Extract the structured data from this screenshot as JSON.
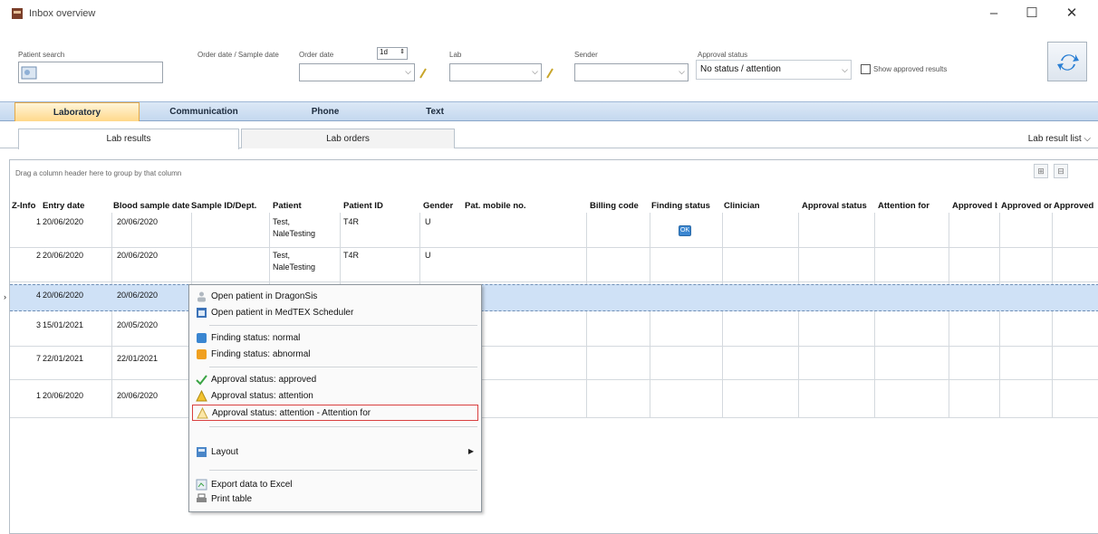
{
  "window": {
    "title": "Inbox overview",
    "minimize": "–",
    "maximize": "☐",
    "close": "✕"
  },
  "filters": {
    "patient_search_label": "Patient search",
    "order_date_label": "Order date / Sample date",
    "order_date_to_label": "Order date",
    "order_date_to_value": "1d",
    "lab_label": "Lab",
    "sender_label": "Sender",
    "approval_label": "Approval status",
    "approval_value": "No status / attention",
    "show_approved_label": "Show approved results"
  },
  "tabs": {
    "main": [
      "Laboratory",
      "Communication",
      "Phone",
      "Text"
    ],
    "sub": [
      "Lab results",
      "Lab orders"
    ],
    "lab_result_list": "Lab result list"
  },
  "grid": {
    "grouping_hint": "Drag a column header here to group by that column",
    "columns": [
      "Z-Info",
      "Entry date",
      "Blood sample date",
      "Sample ID/Dept.",
      "Patient",
      "Patient ID",
      "Gender",
      "Pat. mobile no.",
      "Billing code",
      "Finding status",
      "Clinician",
      "Approval status",
      "Attention for",
      "Approved by",
      "Approved on",
      "Approved"
    ],
    "rows": [
      {
        "num": "1",
        "entry": "20/06/2020",
        "blood": "20/06/2020",
        "patient": "Test,",
        "patient2": "NaleTesting",
        "pid": "T4R",
        "gender": "U",
        "finding": "OK"
      },
      {
        "num": "2",
        "entry": "20/06/2020",
        "blood": "20/06/2020",
        "patient": "Test,",
        "patient2": "NaleTesting",
        "pid": "T4R",
        "gender": "U",
        "finding": ""
      },
      {
        "num": "4",
        "entry": "20/06/2020",
        "blood": "20/06/2020",
        "patient": "",
        "patient2": "",
        "pid": "",
        "gender": "",
        "finding": ""
      },
      {
        "num": "3",
        "entry": "15/01/2021",
        "blood": "20/05/2020",
        "patient": "",
        "patient2": "",
        "pid": "",
        "gender": "",
        "finding": ""
      },
      {
        "num": "7",
        "entry": "22/01/2021",
        "blood": "22/01/2021",
        "patient": "",
        "patient2": "",
        "pid": "",
        "gender": "",
        "finding": ""
      },
      {
        "num": "1",
        "entry": "20/06/2020",
        "blood": "20/06/2020",
        "patient": "",
        "patient2": "",
        "pid": "",
        "gender": "",
        "finding": ""
      }
    ]
  },
  "context_menu": {
    "items": [
      {
        "label": "Open patient in DragonSis",
        "icon": "patient-icon"
      },
      {
        "label": "Open patient in MedTEX Scheduler",
        "icon": "scheduler-icon"
      },
      {
        "label": "Finding status: normal",
        "icon": "normal-status-icon"
      },
      {
        "label": "Finding status: abnormal",
        "icon": "abnormal-status-icon"
      },
      {
        "label": "Approval status: approved",
        "icon": "checkmark-icon"
      },
      {
        "label": "Approval status: attention",
        "icon": "warning-icon"
      },
      {
        "label": "Approval status: attention - Attention for",
        "icon": "warning-outline-icon"
      },
      {
        "label": "Layout",
        "icon": "layout-icon"
      },
      {
        "label": "Export data to Excel",
        "icon": "excel-icon"
      },
      {
        "label": "Print table",
        "icon": "printer-icon"
      }
    ]
  },
  "colors": {
    "tab_active": "#ffd88a",
    "tabbar": "#c4d8ef",
    "selected_row": "#cfe1f6",
    "highlight_border": "#d94040"
  }
}
